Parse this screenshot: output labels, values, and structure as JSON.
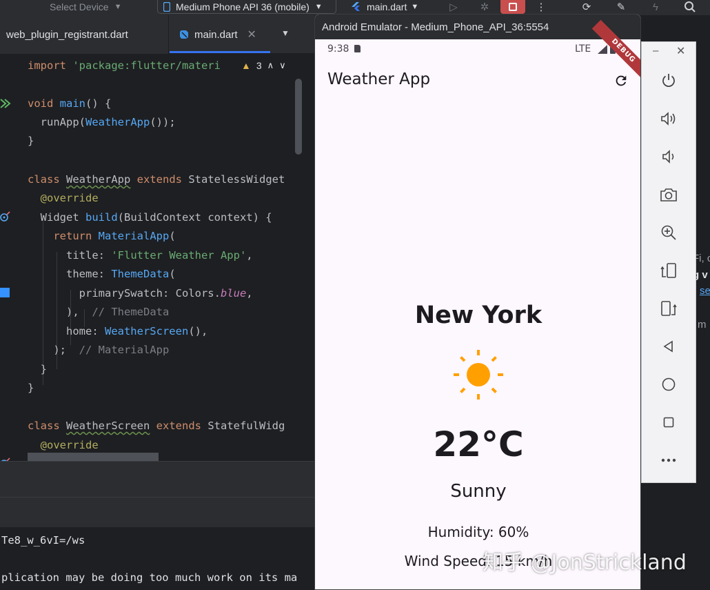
{
  "toolbar": {
    "select_device": "Select Device",
    "device": "Medium Phone API 36 (mobile)",
    "run_config": "main.dart"
  },
  "tabs": [
    {
      "label": "web_plugin_registrant.dart"
    },
    {
      "label": "main.dart"
    }
  ],
  "editor": {
    "warning_count": "3",
    "lines": {
      "l1_kw": "import",
      "l1_str": " 'package:flutter/materi",
      "l3_kw": "void",
      "l3_fn": "main",
      "l3_rest": "() {",
      "l4_a": "  runApp(",
      "l4_cls": "WeatherApp",
      "l4_b": "());",
      "l5": "}",
      "l7_kw": "class",
      "l7_cls": "WeatherApp",
      "l7_kw2": " extends",
      "l7_rest": " StatelessWidget",
      "l8": "  @override",
      "l9_a": "  Widget ",
      "l9_fn": "build",
      "l9_b": "(BuildContext context) {",
      "l10_kw": "    return",
      "l10_cls": " MaterialApp",
      "l10_b": "(",
      "l11_a": "      title: ",
      "l11_str": "'Flutter Weather App'",
      "l11_b": ",",
      "l12_a": "      theme: ",
      "l12_cls": "ThemeData",
      "l12_b": "(",
      "l13_a": "        primarySwatch: Colors.",
      "l13_it": "blue",
      "l13_b": ",",
      "l14_a": "      ),  ",
      "l14_cmt": "// ThemeData",
      "l15_a": "      home: ",
      "l15_cls": "WeatherScreen",
      "l15_b": "(),",
      "l16_a": "    );  ",
      "l16_cmt": "// MaterialApp",
      "l17": "  }",
      "l18": "}",
      "l20_kw": "class",
      "l20_cls": "WeatherScreen",
      "l20_kw2": " extends",
      "l20_rest": " StatefulWidg",
      "l21": "  @override"
    }
  },
  "console": {
    "line1": "Te8_w_6vI=/ws",
    "line2": "plication may be doing too much work on its ma"
  },
  "emulator": {
    "window_title": "Android Emulator - Medium_Phone_API_36:5554",
    "status_time": "9:38",
    "status_network": "LTE",
    "debug_banner": "DEBUG",
    "app": {
      "title": "Weather App",
      "city": "New York",
      "temperature": "22°C",
      "condition": "Sunny",
      "humidity": "Humidity: 60%",
      "wind": "Wind Speed: 15 km/h"
    },
    "controls": [
      "power-icon",
      "volume-up-icon",
      "volume-down-icon",
      "camera-icon",
      "zoom-in-icon",
      "rotate-left-icon",
      "rotate-right-icon",
      "back-icon",
      "home-icon",
      "overview-icon",
      "more-icon"
    ]
  },
  "background_fragments": {
    "f1": "Fi, c",
    "f2": "g v",
    "f3": "se",
    "f4": "m"
  },
  "watermark": "知乎 @JonStrickland",
  "colors": {
    "ide_bg": "#1e1f22",
    "ide_panel": "#2b2d30",
    "accent": "#3574f0",
    "app_bg": "#fdf7fe",
    "sun": "#ffa000",
    "debug_banner": "#b0383b"
  }
}
